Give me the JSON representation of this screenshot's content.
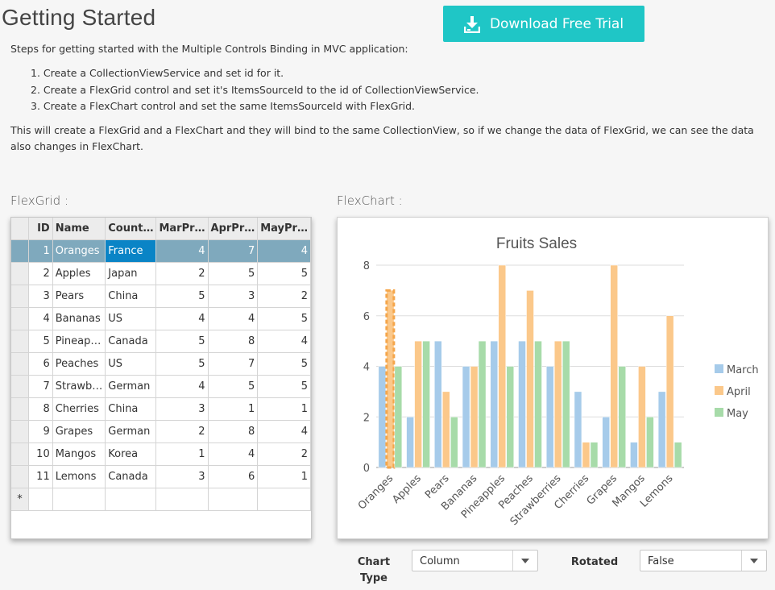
{
  "header": {
    "title": "Getting Started",
    "download_label": "Download Free Trial"
  },
  "intro": "Steps for getting started with the Multiple Controls Binding in MVC application:",
  "steps": [
    "1. Create a CollectionViewService and set id for it.",
    "2. Create a FlexGrid control and set it's ItemsSourceId to the id of CollectionViewService.",
    "3. Create a FlexChart control and set the same ItemsSourceId with FlexGrid."
  ],
  "paragraph": "This will create a FlexGrid and a FlexChart and they will bind to the same CollectionView, so if we change the data of FlexGrid, we can see the data also changes in FlexChart.",
  "grid": {
    "label": "FlexGrid :",
    "columns": [
      "ID",
      "Name",
      "Count…",
      "MarPr…",
      "AprPr…",
      "MayPr…"
    ],
    "rows": [
      [
        "1",
        "Oranges",
        "France",
        "4",
        "7",
        "4"
      ],
      [
        "2",
        "Apples",
        "Japan",
        "2",
        "5",
        "5"
      ],
      [
        "3",
        "Pears",
        "China",
        "5",
        "3",
        "2"
      ],
      [
        "4",
        "Bananas",
        "US",
        "4",
        "4",
        "5"
      ],
      [
        "5",
        "Pineap…",
        "Canada",
        "5",
        "8",
        "4"
      ],
      [
        "6",
        "Peaches",
        "US",
        "5",
        "7",
        "5"
      ],
      [
        "7",
        "Strawb…",
        "German",
        "4",
        "5",
        "5"
      ],
      [
        "8",
        "Cherries",
        "China",
        "3",
        "1",
        "1"
      ],
      [
        "9",
        "Grapes",
        "German",
        "2",
        "8",
        "4"
      ],
      [
        "10",
        "Mangos",
        "Korea",
        "1",
        "4",
        "2"
      ],
      [
        "11",
        "Lemons",
        "Canada",
        "3",
        "6",
        "1"
      ]
    ],
    "new_row_marker": "*"
  },
  "chart": {
    "label": "FlexChart :"
  },
  "chart_data": {
    "type": "bar",
    "title": "Fruits Sales",
    "categories": [
      "Oranges",
      "Apples",
      "Pears",
      "Bananas",
      "Pineapples",
      "Peaches",
      "Strawberries",
      "Cherries",
      "Grapes",
      "Mangos",
      "Lemons"
    ],
    "series": [
      {
        "name": "March",
        "values": [
          4,
          2,
          5,
          4,
          5,
          5,
          4,
          3,
          2,
          1,
          3
        ],
        "color": "#a6cbea"
      },
      {
        "name": "April",
        "values": [
          7,
          5,
          3,
          4,
          8,
          7,
          5,
          1,
          8,
          4,
          6
        ],
        "color": "#fbc88a"
      },
      {
        "name": "May",
        "values": [
          4,
          5,
          2,
          5,
          4,
          5,
          5,
          1,
          4,
          2,
          1
        ],
        "color": "#a7dba9"
      }
    ],
    "ylim": [
      0,
      8
    ],
    "yticks": [
      0,
      2,
      4,
      6,
      8
    ],
    "grid": true,
    "legend": "right",
    "selected": {
      "series": "April",
      "category": "Oranges"
    }
  },
  "controls": {
    "chart_type_label": "Chart\nType",
    "chart_type_value": "Column",
    "rotated_label": "Rotated",
    "rotated_value": "False"
  },
  "colors": {
    "accent": "#1fc6c6",
    "selection": "#7fa9bd",
    "cursor": "#0a84c6"
  }
}
